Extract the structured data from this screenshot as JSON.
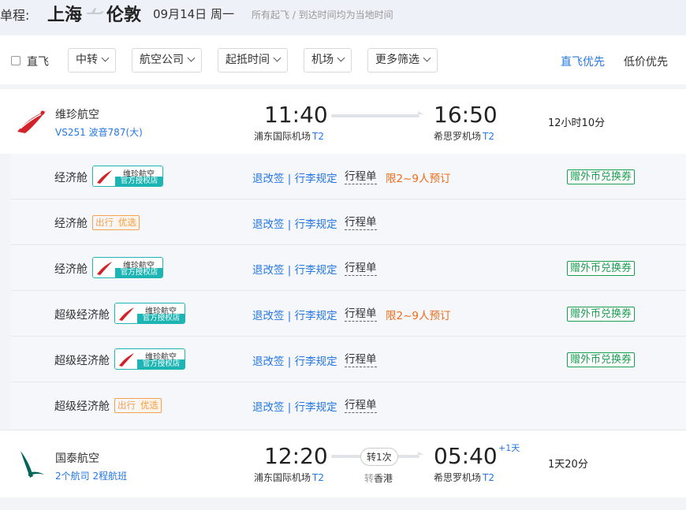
{
  "header": {
    "trip_type": "单程:",
    "origin": "上海",
    "destination": "伦敦",
    "date": "09月14日 周一",
    "note": "所有起飞 / 到达时间均为当地时间"
  },
  "filters": {
    "direct_label": "直飞",
    "dropdowns": [
      "中转",
      "航空公司",
      "起抵时间",
      "机场",
      "更多筛选"
    ],
    "sort_direct": "直飞优先",
    "sort_price": "低价优先"
  },
  "flights": [
    {
      "airline": "维珍航空",
      "flight_info": "VS251 波音787(大)",
      "dep_time": "11:40",
      "dep_airport": "浦东国际机场",
      "dep_terminal": "T2",
      "arr_time": "16:50",
      "arr_airport": "希思罗机场",
      "arr_terminal": "T2",
      "duration": "12小时10分",
      "colors": {
        "logo": "#d2232a"
      }
    },
    {
      "airline": "国泰航空",
      "flight_info": "2个航司  2程航班",
      "dep_time": "12:20",
      "dep_airport": "浦东国际机场",
      "dep_terminal": "T2",
      "transfer": "转1次",
      "transfer_prefix": "转",
      "transfer_city": "香港",
      "arr_time": "05:40",
      "arr_day_offset": "+1天",
      "arr_airport": "希思罗机场",
      "arr_terminal": "T2",
      "duration": "1天20分",
      "colors": {
        "logo": "#00645a"
      }
    }
  ],
  "cabins": [
    {
      "name": "经济舱",
      "badge_type": "official",
      "rules": "退改签 | 行李规定",
      "itinerary": "行程单",
      "limit": "限2~9人预订",
      "gift": "赠外币兑换券"
    },
    {
      "name": "经济舱",
      "badge_type": "preferred",
      "rules": "退改签 | 行李规定",
      "itinerary": "行程单",
      "limit": "",
      "gift": ""
    },
    {
      "name": "经济舱",
      "badge_type": "official",
      "rules": "退改签 | 行李规定",
      "itinerary": "行程单",
      "limit": "",
      "gift": "赠外币兑换券"
    },
    {
      "name": "超级经济舱",
      "badge_type": "official",
      "rules": "退改签 | 行李规定",
      "itinerary": "行程单",
      "limit": "限2~9人预订",
      "gift": "赠外币兑换券"
    },
    {
      "name": "超级经济舱",
      "badge_type": "official",
      "rules": "退改签 | 行李规定",
      "itinerary": "行程单",
      "limit": "",
      "gift": "赠外币兑换券"
    },
    {
      "name": "超级经济舱",
      "badge_type": "preferred",
      "rules": "退改签 | 行李规定",
      "itinerary": "行程单",
      "limit": "",
      "gift": ""
    }
  ],
  "badges": {
    "official_line1": "维珍航空",
    "official_line2": "官方授权店",
    "preferred_part1": "出行",
    "preferred_part2": "优选"
  },
  "colors": {
    "accent": "#2577e3",
    "limit": "#f06c1a",
    "gift": "#1a9e52",
    "official_badge": "#1cb5b3",
    "preferred_badge": "#f5a04c"
  }
}
